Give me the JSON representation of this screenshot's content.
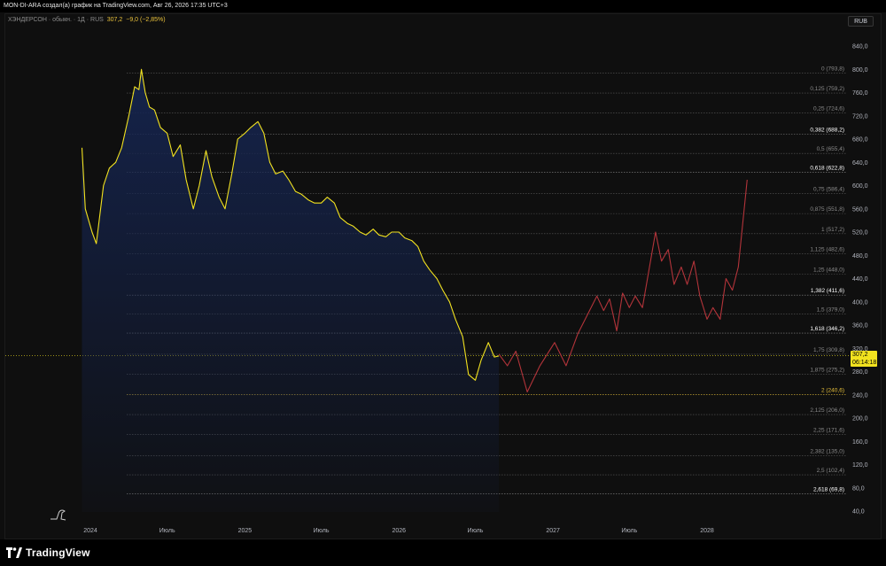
{
  "header": {
    "attribution": "MON-DI-ARA создал(а) график на TradingView.com, Авг 26, 2026 17:35 UTC+3"
  },
  "legend": {
    "symbol": "ХЭНДЕРСОН · обыкн. · 1Д · RUS",
    "price": "307,2",
    "change": "−9,0 (−2,85%)"
  },
  "currency_button": "RUB",
  "price_tag": {
    "price": "307,2",
    "countdown": "06:14:18"
  },
  "footer": {
    "brand": "TradingView"
  },
  "colors": {
    "background": "#0f0f0f",
    "price_line": "#f2e21f",
    "area_fill_top": "#15244e",
    "projection": "#b3343a",
    "fib_line": "#5a5a5a",
    "fib_highlight": "#e8c13b"
  },
  "chart_data": {
    "type": "line",
    "title": "",
    "xlabel": "",
    "ylabel": "",
    "ylim": [
      40,
      860
    ],
    "y_ticks": [
      "840,0",
      "800,0",
      "760,0",
      "720,0",
      "680,0",
      "640,0",
      "600,0",
      "560,0",
      "520,0",
      "480,0",
      "440,0",
      "400,0",
      "360,0",
      "320,0",
      "280,0",
      "240,0",
      "200,0",
      "160,0",
      "120,0",
      "80,0",
      "40,0"
    ],
    "x_ticks": [
      "2024",
      "Июль",
      "2025",
      "Июль",
      "2026",
      "Июль",
      "2027",
      "Июль",
      "2028"
    ],
    "x_tick_dates": [
      "2024-01-01",
      "2024-07-01",
      "2025-01-01",
      "2025-07-01",
      "2026-01-01",
      "2026-07-01",
      "2027-01-01",
      "2027-07-01",
      "2028-01-01"
    ],
    "series": [
      {
        "name": "",
        "style": "price",
        "x": [
          "2023-12-12",
          "2023-12-20",
          "2024-01-05",
          "2024-01-15",
          "2024-02-01",
          "2024-02-15",
          "2024-03-01",
          "2024-03-15",
          "2024-04-01",
          "2024-04-15",
          "2024-04-25",
          "2024-05-01",
          "2024-05-10",
          "2024-05-20",
          "2024-06-01",
          "2024-06-15",
          "2024-07-01",
          "2024-07-15",
          "2024-08-01",
          "2024-08-15",
          "2024-09-01",
          "2024-09-15",
          "2024-10-01",
          "2024-10-15",
          "2024-11-01",
          "2024-11-15",
          "2024-12-01",
          "2024-12-15",
          "2025-01-01",
          "2025-01-15",
          "2025-02-01",
          "2025-02-15",
          "2025-03-01",
          "2025-03-15",
          "2025-04-01",
          "2025-04-15",
          "2025-05-01",
          "2025-05-15",
          "2025-06-01",
          "2025-06-15",
          "2025-07-01",
          "2025-07-15",
          "2025-08-01",
          "2025-08-15",
          "2025-09-01",
          "2025-09-15",
          "2025-10-01",
          "2025-10-15",
          "2025-11-01",
          "2025-11-15",
          "2025-12-01",
          "2025-12-15",
          "2026-01-01",
          "2026-01-15",
          "2026-02-01",
          "2026-02-15",
          "2026-03-01",
          "2026-03-15",
          "2026-04-01",
          "2026-04-15",
          "2026-05-01",
          "2026-05-15",
          "2026-06-01",
          "2026-06-15",
          "2026-07-01",
          "2026-07-15",
          "2026-08-01",
          "2026-08-15",
          "2026-08-26"
        ],
        "values": [
          665,
          560,
          520,
          500,
          600,
          630,
          640,
          665,
          720,
          770,
          765,
          800,
          760,
          735,
          730,
          700,
          690,
          650,
          670,
          610,
          560,
          600,
          660,
          615,
          580,
          560,
          620,
          680,
          690,
          700,
          710,
          690,
          640,
          620,
          625,
          610,
          590,
          585,
          575,
          570,
          570,
          580,
          570,
          545,
          535,
          530,
          520,
          515,
          525,
          515,
          512,
          520,
          520,
          510,
          505,
          495,
          470,
          455,
          440,
          420,
          400,
          370,
          340,
          275,
          265,
          300,
          330,
          305,
          307
        ]
      },
      {
        "name": "",
        "style": "projection",
        "x": [
          "2026-08-26",
          "2026-09-15",
          "2026-10-05",
          "2026-11-01",
          "2026-12-01",
          "2027-01-05",
          "2027-02-01",
          "2027-03-01",
          "2027-04-15",
          "2027-05-01",
          "2027-05-15",
          "2027-06-01",
          "2027-06-15",
          "2027-07-01",
          "2027-07-15",
          "2027-08-01",
          "2027-09-01",
          "2027-09-15",
          "2027-10-01",
          "2027-10-15",
          "2027-11-01",
          "2027-11-15",
          "2027-12-01",
          "2027-12-15",
          "2028-01-01",
          "2028-01-15",
          "2028-02-01",
          "2028-02-15",
          "2028-03-01",
          "2028-03-15",
          "2028-04-05"
        ],
        "values": [
          310,
          290,
          315,
          245,
          290,
          330,
          290,
          345,
          410,
          385,
          405,
          350,
          415,
          390,
          410,
          390,
          520,
          470,
          490,
          430,
          460,
          430,
          470,
          410,
          370,
          390,
          370,
          440,
          420,
          460,
          610
        ]
      }
    ],
    "fib_levels": [
      {
        "ratio": "0",
        "price": "793,8",
        "value": 793.8,
        "highlight": false
      },
      {
        "ratio": "0,125",
        "price": "759,2",
        "value": 759.2,
        "highlight": false
      },
      {
        "ratio": "0,25",
        "price": "724,6",
        "value": 724.6,
        "highlight": false
      },
      {
        "ratio": "0,382",
        "price": "688,2",
        "value": 688.2,
        "highlight": true
      },
      {
        "ratio": "0,5",
        "price": "655,4",
        "value": 655.4,
        "highlight": false
      },
      {
        "ratio": "0,618",
        "price": "622,8",
        "value": 622.8,
        "highlight": true
      },
      {
        "ratio": "0,75",
        "price": "586,4",
        "value": 586.4,
        "highlight": false
      },
      {
        "ratio": "0,875",
        "price": "551,8",
        "value": 551.8,
        "highlight": false
      },
      {
        "ratio": "1",
        "price": "517,2",
        "value": 517.2,
        "highlight": false
      },
      {
        "ratio": "1,125",
        "price": "482,6",
        "value": 482.6,
        "highlight": false
      },
      {
        "ratio": "1,25",
        "price": "448,0",
        "value": 448.0,
        "highlight": false
      },
      {
        "ratio": "1,382",
        "price": "411,6",
        "value": 411.6,
        "highlight": true
      },
      {
        "ratio": "1,5",
        "price": "379,0",
        "value": 379.0,
        "highlight": false
      },
      {
        "ratio": "1,618",
        "price": "346,2",
        "value": 346.2,
        "highlight": true
      },
      {
        "ratio": "1,75",
        "price": "309,8",
        "value": 309.8,
        "highlight": false
      },
      {
        "ratio": "1,875",
        "price": "275,2",
        "value": 275.2,
        "highlight": false
      },
      {
        "ratio": "2",
        "price": "240,6",
        "value": 240.6,
        "highlight": true,
        "accent": true
      },
      {
        "ratio": "2,125",
        "price": "206,0",
        "value": 206.0,
        "highlight": false
      },
      {
        "ratio": "2,25",
        "price": "171,6",
        "value": 171.6,
        "highlight": false
      },
      {
        "ratio": "2,382",
        "price": "135,0",
        "value": 135.0,
        "highlight": false
      },
      {
        "ratio": "2,5",
        "price": "102,4",
        "value": 102.4,
        "highlight": false
      },
      {
        "ratio": "2,618",
        "price": "69,8",
        "value": 69.8,
        "highlight": true
      }
    ],
    "current_price": 307.2,
    "grid": false,
    "legend": "top-left"
  }
}
